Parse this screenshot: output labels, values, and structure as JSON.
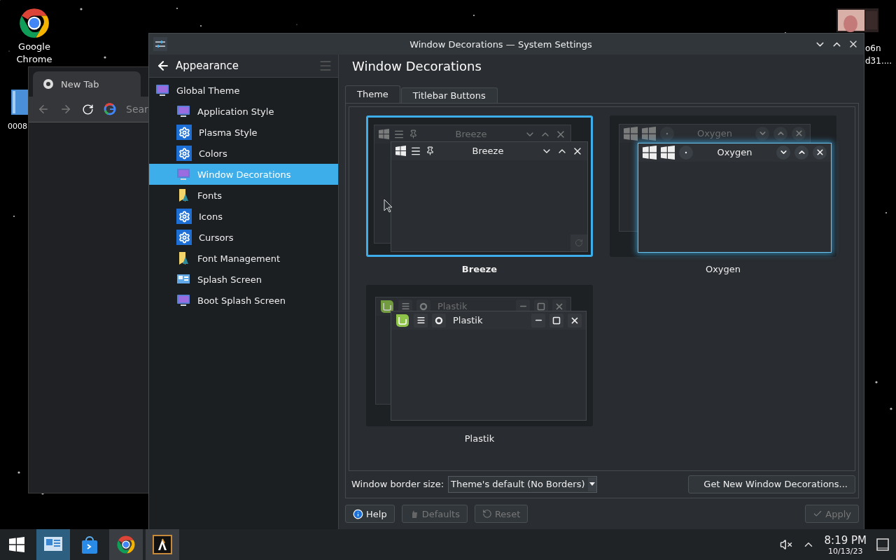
{
  "desktop": {
    "icons": [
      {
        "kind": "chrome",
        "label": "Google Chrome"
      },
      {
        "kind": "video",
        "label": "0008"
      },
      {
        "kind": "thumbnail",
        "label_lines": [
          "o6n",
          "d31...."
        ]
      }
    ]
  },
  "browser": {
    "tab_title": "New Tab",
    "address_placeholder": "Sear"
  },
  "settings": {
    "title": "Window Decorations — System Settings",
    "sidebar": {
      "header": "Appearance",
      "items": [
        {
          "label": "Global Theme",
          "kind": "monitor",
          "selected": false,
          "children": [
            {
              "label": "Application Style",
              "kind": "monitor",
              "selected": false
            },
            {
              "label": "Plasma Style",
              "kind": "gear",
              "selected": false
            },
            {
              "label": "Colors",
              "kind": "gear",
              "selected": false
            },
            {
              "label": "Window Decorations",
              "kind": "monitor",
              "selected": true
            },
            {
              "label": "Fonts",
              "kind": "font",
              "selected": false
            },
            {
              "label": "Icons",
              "kind": "gear",
              "selected": false
            },
            {
              "label": "Cursors",
              "kind": "gear",
              "selected": false
            },
            {
              "label": "Font Management",
              "kind": "font",
              "selected": false
            },
            {
              "label": "Splash Screen",
              "kind": "splash",
              "selected": false
            },
            {
              "label": "Boot Splash Screen",
              "kind": "monitor",
              "selected": false
            }
          ]
        }
      ]
    },
    "heading": "Window Decorations",
    "tabs": [
      {
        "label": "Theme",
        "selected": true
      },
      {
        "label": "Titlebar Buttons",
        "selected": false
      }
    ],
    "decorations": [
      {
        "kind": "breeze",
        "back_title": "Breeze",
        "front_title": "Breeze",
        "label": "Breeze",
        "selected": true
      },
      {
        "kind": "oxygen",
        "back_title": "Oxygen",
        "front_title": "Oxygen",
        "label": "Oxygen",
        "selected": false
      },
      {
        "kind": "plastik",
        "back_title": "Plastik",
        "front_title": "Plastik",
        "label": "Plastik",
        "selected": false
      }
    ],
    "border_size": {
      "label": "Window border size:",
      "value": "Theme's default (No Borders)"
    },
    "get_new_button": "Get New Window Decorations...",
    "footer_buttons": [
      {
        "kind": "help",
        "label": "Help",
        "disabled": false
      },
      {
        "kind": "defaults",
        "label": "Defaults",
        "disabled": true
      },
      {
        "kind": "reset",
        "label": "Reset",
        "disabled": true
      },
      {
        "kind": "apply",
        "label": "Apply",
        "disabled": true
      }
    ]
  },
  "taskbar": {
    "apps": [
      {
        "kind": "settings",
        "selected": true,
        "running": true
      },
      {
        "kind": "store",
        "selected": false,
        "running": false
      },
      {
        "kind": "chrome",
        "selected": false,
        "running": true
      },
      {
        "kind": "krita",
        "selected": false,
        "running": true
      }
    ],
    "time": "8:19 PM",
    "date": "10/13/23"
  }
}
